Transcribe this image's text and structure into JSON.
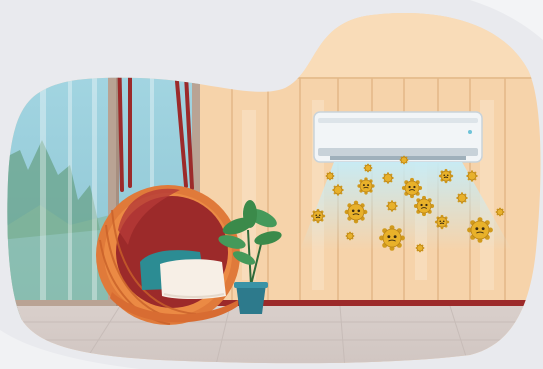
{
  "scene": {
    "subject": "air-conditioner-blowing-germs",
    "icons": [
      "hanging-egg-chair-icon",
      "cushion-icon",
      "potted-plant-icon",
      "air-conditioner-icon",
      "germ-icon"
    ],
    "germ_count": 20,
    "colors": {
      "background": "#e9eaee",
      "wall_panel": "#f6d3aa",
      "wall_seam": "#e0b27e",
      "window_sky": "#9fd3df",
      "window_frame": "#b8a193",
      "ac_body": "#f2f5f7",
      "airflow": "#bfe8f4",
      "germ": "#e8b12a",
      "chair_wicker": "#e07a3a",
      "chair_inner": "#9c2a2a",
      "floor": "#d8d0cd",
      "baseboard": "#9c2a2a",
      "plant": "#3b8a4a",
      "pot": "#2d7a8c"
    }
  }
}
